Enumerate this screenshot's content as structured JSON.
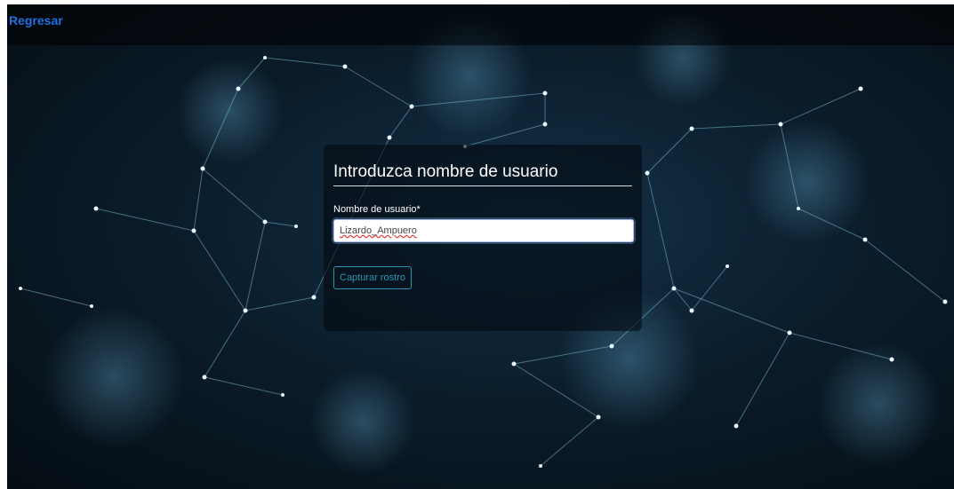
{
  "navbar": {
    "back_label": "Regresar"
  },
  "form": {
    "title": "Introduzca nombre de usuario",
    "field_label": "Nombre de usuario*",
    "field_value": "Lizardo_Ampuero",
    "submit_label": "Capturar rostro"
  },
  "colors": {
    "link": "#1f6fe0",
    "button_outline": "#2a95b0",
    "background": "#0b1d2b"
  }
}
